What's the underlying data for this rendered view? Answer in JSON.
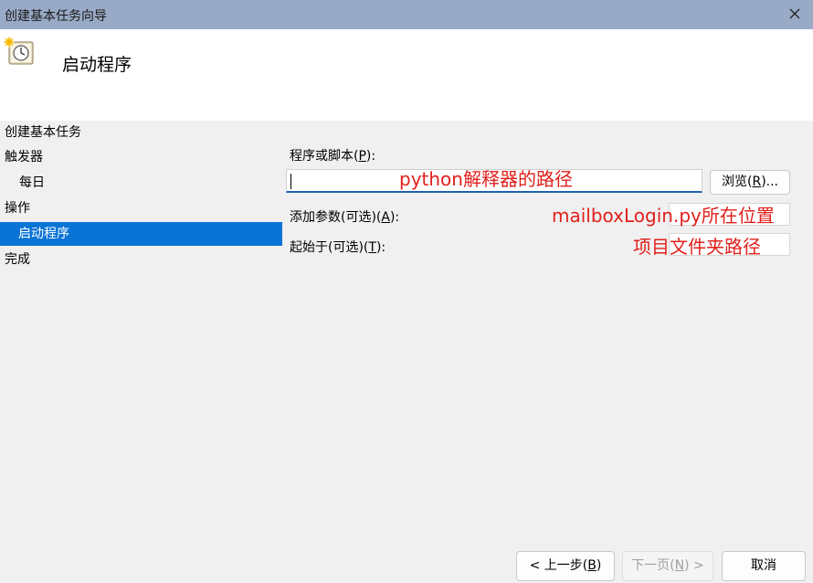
{
  "window": {
    "title": "创建基本任务向导"
  },
  "header": {
    "title": "启动程序"
  },
  "steps": [
    {
      "label": "创建基本任务"
    },
    {
      "label": "触发器"
    },
    {
      "label": "每日"
    },
    {
      "label": "操作"
    },
    {
      "label": "启动程序"
    },
    {
      "label": "完成"
    }
  ],
  "form": {
    "program_label_pre": "程序或脚本(",
    "program_key": "P",
    "program_label_post": "):",
    "program_value": "",
    "browse_pre": "浏览(",
    "browse_key": "R",
    "browse_post": ")...",
    "args_pre": "添加参数(可选)(",
    "args_key": "A",
    "args_post": "):",
    "args_value": "",
    "start_pre": "起始于(可选)(",
    "start_key": "T",
    "start_post": "):",
    "start_value": ""
  },
  "annotations": {
    "program": "python解释器的路径",
    "args": "mailboxLogin.py所在位置",
    "start": "项目文件夹路径"
  },
  "buttons": {
    "back_pre": "< 上一步(",
    "back_key": "B",
    "back_post": ")",
    "next_pre": "下一页(",
    "next_key": "N",
    "next_post": ") >",
    "cancel": "取消"
  },
  "colors": {
    "selected_step": "#0a74d6",
    "annotation": "#e0201c",
    "titlebar": "#99aac6"
  }
}
